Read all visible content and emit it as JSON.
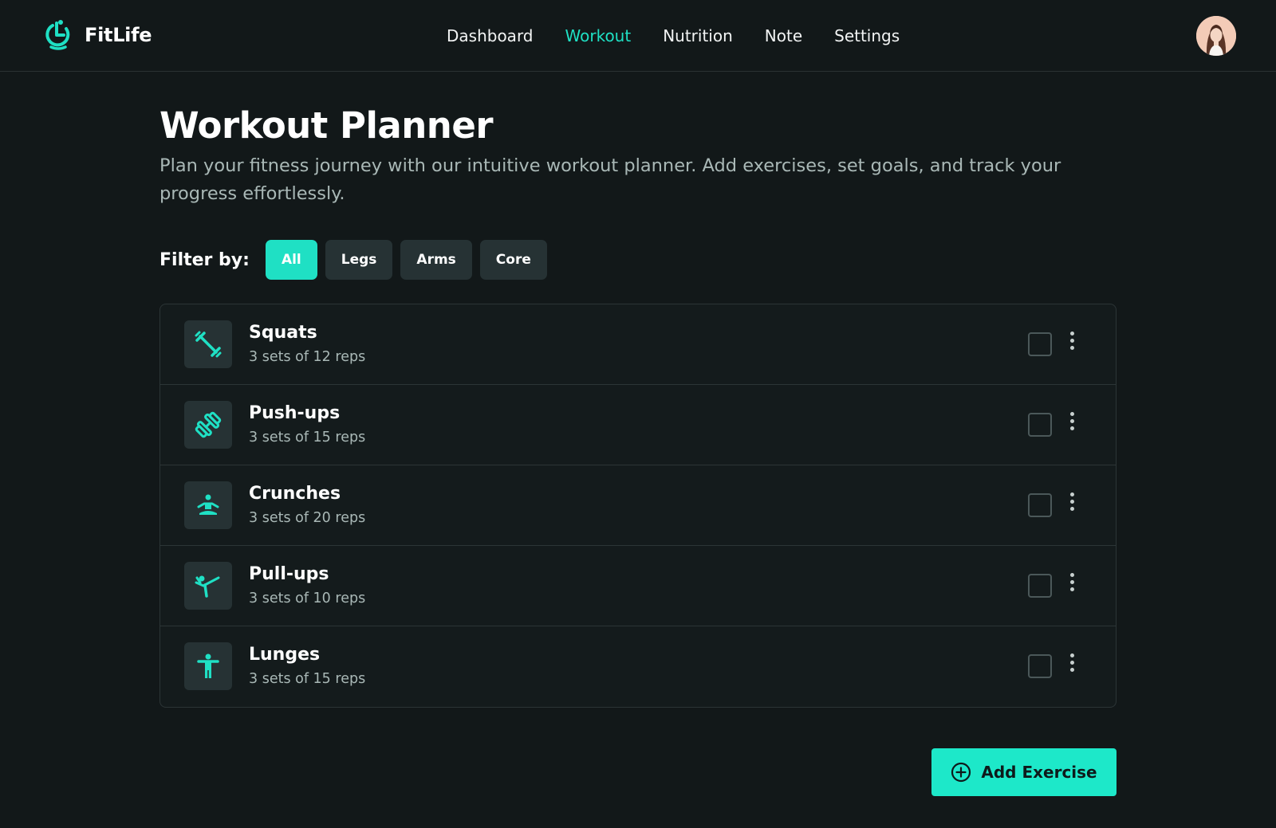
{
  "app": {
    "name": "FitLife",
    "accent_color": "#1fe0c4",
    "background_color": "#121819"
  },
  "nav": {
    "items": [
      {
        "label": "Dashboard",
        "active": false
      },
      {
        "label": "Workout",
        "active": true
      },
      {
        "label": "Nutrition",
        "active": false
      },
      {
        "label": "Note",
        "active": false
      },
      {
        "label": "Settings",
        "active": false
      }
    ],
    "avatar_icon": "user-avatar"
  },
  "page": {
    "title": "Workout Planner",
    "description": "Plan your fitness journey with our intuitive workout planner. Add exercises, set goals, and track your progress effortlessly."
  },
  "filters": {
    "label": "Filter by:",
    "options": [
      {
        "label": "All",
        "active": true
      },
      {
        "label": "Legs",
        "active": false
      },
      {
        "label": "Arms",
        "active": false
      },
      {
        "label": "Core",
        "active": false
      }
    ]
  },
  "exercises": [
    {
      "name": "Squats",
      "detail": "3 sets of 12 reps",
      "icon": "dumbbell-diagonal-icon",
      "checked": false
    },
    {
      "name": "Push-ups",
      "detail": "3 sets of 15 reps",
      "icon": "fitness-dumbbell-icon",
      "checked": false
    },
    {
      "name": "Crunches",
      "detail": "3 sets of 20 reps",
      "icon": "meditation-icon",
      "checked": false
    },
    {
      "name": "Pull-ups",
      "detail": "3 sets of 10 reps",
      "icon": "sports-kick-icon",
      "checked": false
    },
    {
      "name": "Lunges",
      "detail": "3 sets of 15 reps",
      "icon": "standing-person-icon",
      "checked": false
    }
  ],
  "actions": {
    "add_label": "Add Exercise",
    "add_icon": "plus-circle-icon"
  }
}
